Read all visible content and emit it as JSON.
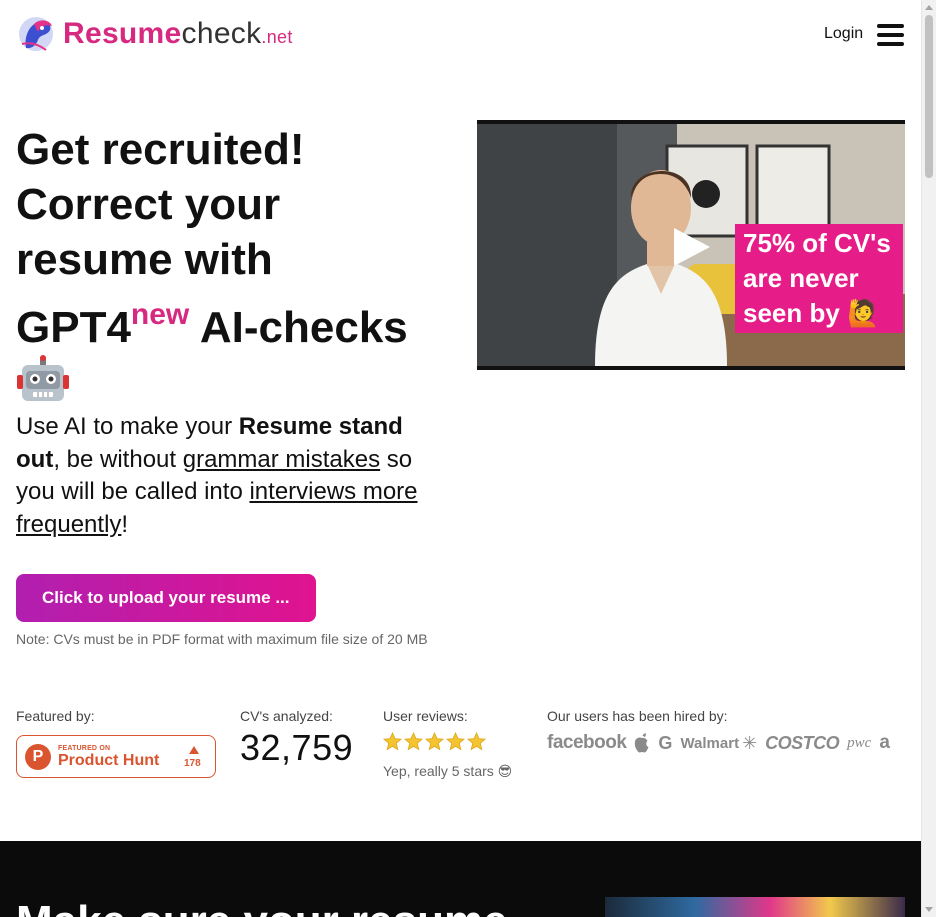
{
  "header": {
    "logo": {
      "part1": "Resume",
      "part2": "check",
      "part3": ".net"
    },
    "login_label": "Login"
  },
  "hero": {
    "headline_line1": "Get recruited!",
    "headline_line2": "Correct your",
    "headline_line3": "resume with",
    "headline_gpt": "GPT4",
    "headline_new": "new",
    "headline_ai": " AI-checks",
    "subhead": {
      "t1": "Use AI to make your ",
      "b1": "Resume stand out",
      "t2": ", be without ",
      "link1": "grammar mistakes",
      "t3": " so you will be called into ",
      "link2": "interviews more frequently",
      "t4": "!"
    },
    "upload_label": "Click to upload your resume ...",
    "note": "Note: CVs must be in PDF format with maximum file size of 20 MB"
  },
  "video": {
    "caption_line1": "75% of CV's",
    "caption_line2": "are never",
    "caption_line3": "seen by 🙋"
  },
  "stats": {
    "featured_label": "Featured by:",
    "product_hunt": {
      "small": "FEATURED ON",
      "big": "Product Hunt",
      "count": "178",
      "letter": "P"
    },
    "cvs_label": "CV's analyzed:",
    "cvs_value": "32,759",
    "reviews_label": "User reviews:",
    "reviews_stars": 5,
    "reviews_sub": "Yep, really 5 stars 😎",
    "hired_label": "Our users has been hired by:",
    "hired_logos": {
      "facebook": "facebook",
      "google": "G",
      "walmart": "Walmart",
      "costco": "COSTCO",
      "pwc": "pwc",
      "amazon": "a"
    }
  },
  "next_section": {
    "title": "Make sure your resume"
  },
  "colors": {
    "brand_pink": "#d6297f",
    "button_start": "#b11fb0",
    "button_end": "#e0138f",
    "star": "#f4c430",
    "product_hunt": "#da552f"
  }
}
